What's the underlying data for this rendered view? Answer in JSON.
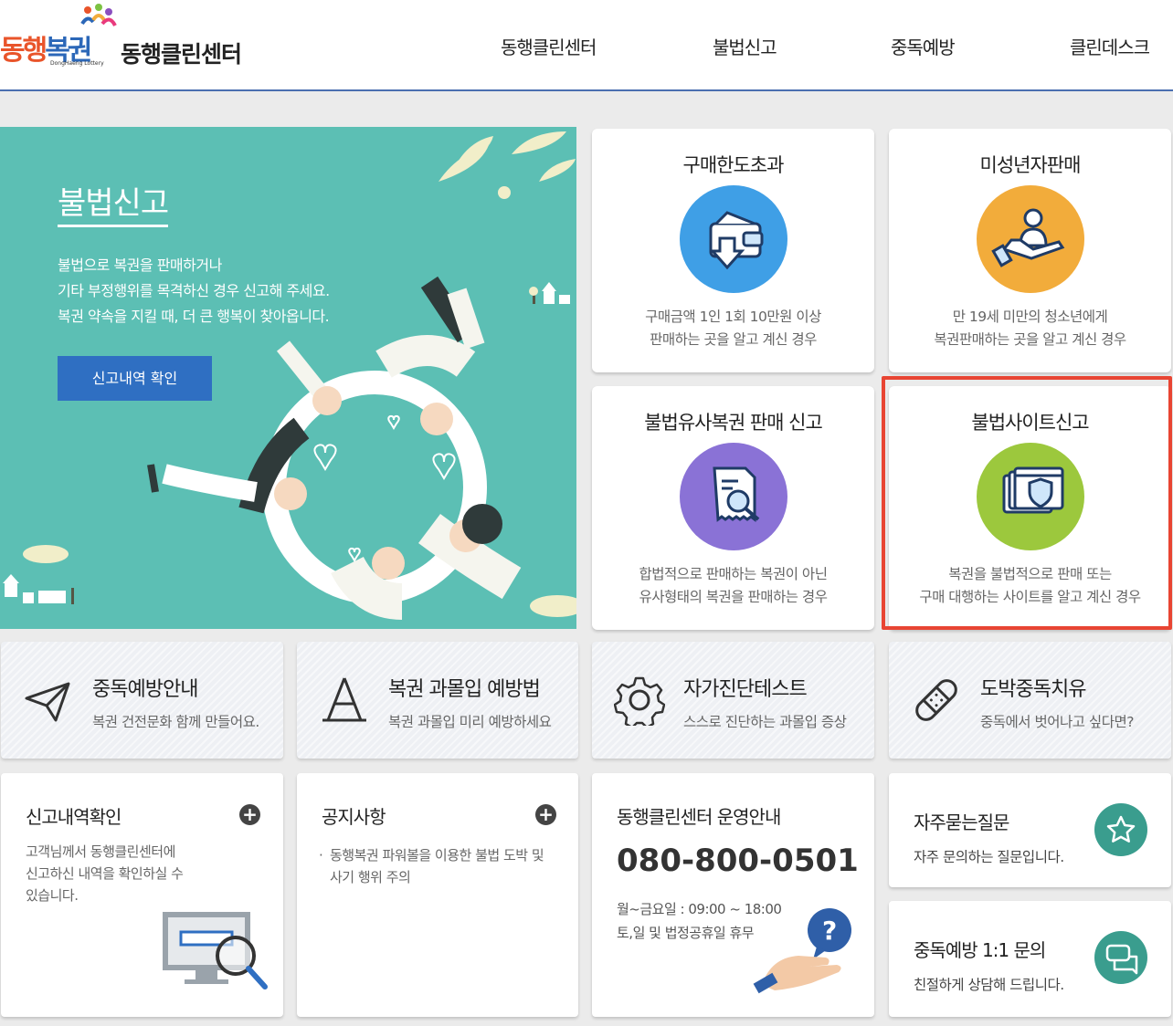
{
  "header": {
    "logo_text_1": "동행",
    "logo_text_2": "복권",
    "logo_sub": "DongHaeng Lottery",
    "site_name": "동행클린센터",
    "nav": [
      "동행클린센터",
      "불법신고",
      "중독예방",
      "클린데스크"
    ]
  },
  "banner": {
    "title": "불법신고",
    "desc": [
      "불법으로 복권을 판매하거나",
      "기타 부정행위를 목격하신 경우 신고해 주세요.",
      "복권 약속을 지킬 때, 더 큰 행복이 찾아옵니다."
    ],
    "button": "신고내역 확인"
  },
  "services": [
    {
      "title": "구매한도초과",
      "desc": [
        "구매금액 1인 1회 10만원 이상",
        "판매하는 곳을 알고 계신 경우"
      ],
      "icon": "wallet-down-icon",
      "color": "#3f9fe6"
    },
    {
      "title": "미성년자판매",
      "desc": [
        "만 19세 미만의 청소년에게",
        "복권판매하는 곳을 알고 계신 경우"
      ],
      "icon": "hand-person-icon",
      "color": "#f2ac3b"
    },
    {
      "title": "불법유사복권 판매 신고",
      "desc": [
        "합법적으로 판매하는 복권이 아닌",
        "유사형태의 복권을 판매하는 경우"
      ],
      "icon": "document-magnifier-icon",
      "color": "#8a72d6"
    },
    {
      "title": "불법사이트신고",
      "desc": [
        "복권을 불법적으로 판매 또는",
        "구매 대행하는 사이트를 알고 계신 경우"
      ],
      "icon": "browser-shield-icon",
      "color": "#9cc83d"
    }
  ],
  "highlight_color": "#e84533",
  "shortcuts": [
    {
      "title": "중독예방안내",
      "sub": "복권 건전문화 함께 만들어요.",
      "icon": "paper-plane-icon"
    },
    {
      "title": "복권 과몰입 예방법",
      "sub": "복권 과몰입 미리 예방하세요",
      "icon": "a-sign-icon"
    },
    {
      "title": "자가진단테스트",
      "sub": "스스로 진단하는 과몰입 증상",
      "icon": "gear-icon"
    },
    {
      "title": "도박중독치유",
      "sub": "중독에서 벗어나고 싶다면?",
      "icon": "bandage-icon"
    }
  ],
  "report_check": {
    "title": "신고내역확인",
    "text": [
      "고객님께서 동행클린센터에",
      "신고하신 내역을 확인하실 수",
      "있습니다."
    ]
  },
  "notice": {
    "title": "공지사항",
    "items": [
      "동행복권 파워볼을 이용한 불법 도박 및",
      "사기 행위 주의"
    ]
  },
  "center_info": {
    "title": "동행클린센터 운영안내",
    "phone": "080-800-0501",
    "hours": [
      "월~금요일 : 09:00 ~ 18:00",
      "토,일 및 법정공휴일 휴무"
    ]
  },
  "faq": {
    "title": "자주묻는질문",
    "sub": "자주 문의하는 질문입니다."
  },
  "inquiry": {
    "title": "중독예방 1:1 문의",
    "sub": "친절하게 상담해 드립니다."
  }
}
